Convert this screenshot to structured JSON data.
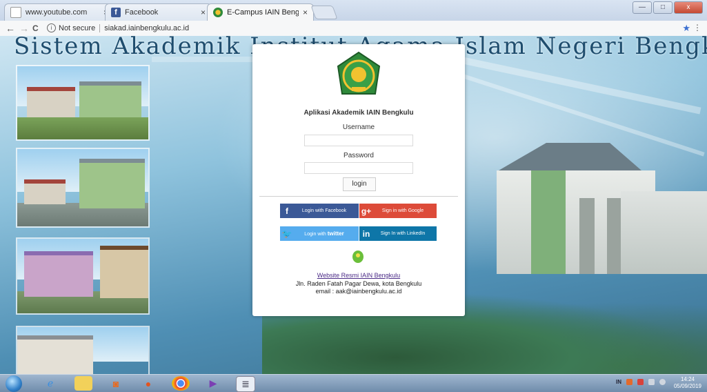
{
  "browser": {
    "tabs": [
      {
        "label": "www.youtube.com",
        "close": "×",
        "active": false
      },
      {
        "label": "Facebook",
        "close": "×",
        "active": false
      },
      {
        "label": "E-Campus IAIN Bengkulu",
        "close": "×",
        "active": true
      }
    ],
    "nav": {
      "back": "←",
      "forward": "→",
      "reload": "C"
    },
    "address": {
      "security_text": "Not secure",
      "url": "siakad.iainbengkulu.ac.id"
    },
    "window_controls": {
      "minimize": "—",
      "maximize": "□",
      "close": "x"
    }
  },
  "page": {
    "hero_title": "Sistem Akademik Institut Agama Islam Negeri Bengkulu",
    "login_card": {
      "app_title": "Aplikasi Akademik IAIN Bengkulu",
      "username_label": "Username",
      "username_value": "",
      "password_label": "Password",
      "password_value": "",
      "login_button": "login",
      "social": {
        "facebook": "Login with Facebook",
        "google": "Sign in with Google",
        "twitter_prefix": "Login with",
        "twitter_brand": "twitter",
        "linkedin": "Sign In with LinkedIn"
      },
      "footer": {
        "website_link": "Website Resmi IAIN Bengkulu",
        "address": "Jln. Raden Fatah Pagar Dewa, kota Bengkulu",
        "email": "email : aak@iainbengkulu.ac.id"
      }
    }
  },
  "taskbar": {
    "clock_time": "14:24",
    "clock_date": "05/09/2019",
    "tray_lang": "IN"
  },
  "colors": {
    "facebook": "#3b5997",
    "google": "#dd4b39",
    "twitter": "#55acee",
    "linkedin": "#0e76a8",
    "link": "#4a2a86"
  }
}
